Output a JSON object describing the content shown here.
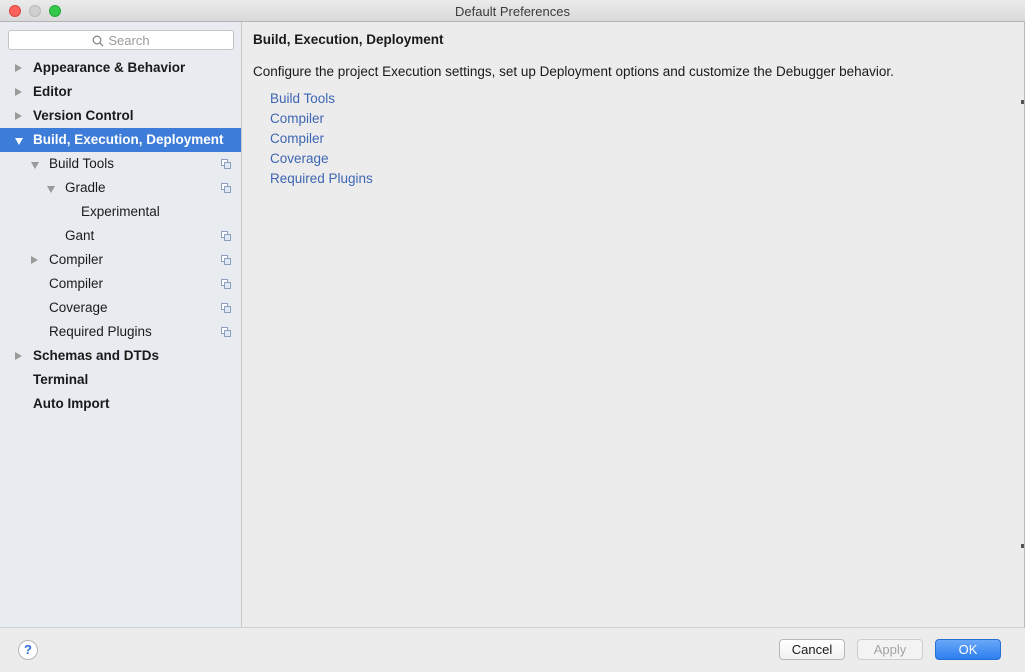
{
  "window": {
    "title": "Default Preferences"
  },
  "search": {
    "placeholder": "Search"
  },
  "tree": [
    {
      "label": "Appearance & Behavior",
      "level": 0,
      "bold": true,
      "arrow": "right",
      "copy": false,
      "selected": false
    },
    {
      "label": "Editor",
      "level": 0,
      "bold": true,
      "arrow": "right",
      "copy": false,
      "selected": false
    },
    {
      "label": "Version Control",
      "level": 0,
      "bold": true,
      "arrow": "right",
      "copy": false,
      "selected": false
    },
    {
      "label": "Build, Execution, Deployment",
      "level": 0,
      "bold": true,
      "arrow": "down",
      "copy": false,
      "selected": true
    },
    {
      "label": "Build Tools",
      "level": 1,
      "bold": false,
      "arrow": "down",
      "copy": true,
      "selected": false
    },
    {
      "label": "Gradle",
      "level": 2,
      "bold": false,
      "arrow": "down",
      "copy": true,
      "selected": false
    },
    {
      "label": "Experimental",
      "level": 3,
      "bold": false,
      "arrow": "none",
      "copy": false,
      "selected": false
    },
    {
      "label": "Gant",
      "level": 2,
      "bold": false,
      "arrow": "none",
      "copy": true,
      "selected": false
    },
    {
      "label": "Compiler",
      "level": 1,
      "bold": false,
      "arrow": "right",
      "copy": true,
      "selected": false
    },
    {
      "label": "Compiler",
      "level": 1,
      "bold": false,
      "arrow": "none",
      "copy": true,
      "selected": false
    },
    {
      "label": "Coverage",
      "level": 1,
      "bold": false,
      "arrow": "none",
      "copy": true,
      "selected": false
    },
    {
      "label": "Required Plugins",
      "level": 1,
      "bold": false,
      "arrow": "none",
      "copy": true,
      "selected": false
    },
    {
      "label": "Schemas and DTDs",
      "level": 0,
      "bold": true,
      "arrow": "right",
      "copy": false,
      "selected": false
    },
    {
      "label": "Terminal",
      "level": 0,
      "bold": true,
      "arrow": "none",
      "copy": false,
      "selected": false
    },
    {
      "label": "Auto Import",
      "level": 0,
      "bold": true,
      "arrow": "none",
      "copy": false,
      "selected": false
    }
  ],
  "content": {
    "breadcrumb": "Build, Execution, Deployment",
    "description": "Configure the project Execution settings, set up Deployment options and customize the Debugger behavior.",
    "links": [
      "Build Tools",
      "Compiler",
      "Compiler",
      "Coverage",
      "Required Plugins"
    ]
  },
  "buttons": {
    "help": "?",
    "cancel": "Cancel",
    "apply": "Apply",
    "ok": "OK"
  },
  "colors": {
    "selection": "#3d7cd8",
    "link": "#3e66b2",
    "ok_button": "#2d7ef0"
  }
}
